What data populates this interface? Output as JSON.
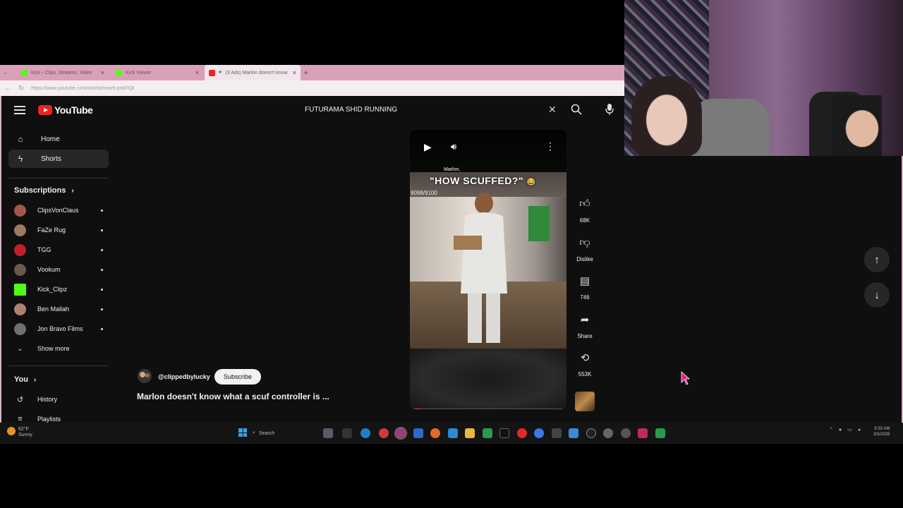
{
  "browser": {
    "tabs": [
      {
        "label": "Kick - Clips, Streams, Video",
        "active": false
      },
      {
        "label": "Kick Viewer",
        "active": false
      },
      {
        "label": "(3 Ads) Marlon doesn't know",
        "active": true
      }
    ],
    "url": "https://www.youtube.com/shorts/mwvh-pn6FQk"
  },
  "youtube": {
    "logo_text": "YouTube",
    "search_query": "FUTURAMA SHID RUNNING",
    "nav": [
      {
        "label": "Home",
        "icon": "home-icon"
      },
      {
        "label": "Shorts",
        "icon": "shorts-icon",
        "active": true
      }
    ],
    "subscriptions_title": "Subscriptions",
    "subscriptions": [
      {
        "name": "ClipsVonClaus",
        "color": "#a0584a"
      },
      {
        "name": "FaZe Rug",
        "color": "#9c7a60"
      },
      {
        "name": "TGG",
        "color": "#c0202a"
      },
      {
        "name": "Vookum",
        "color": "#6a5a4a"
      },
      {
        "name": "Kick_Clipz",
        "color": "#53fc18"
      },
      {
        "name": "Ben Mallah",
        "color": "#b08070"
      },
      {
        "name": "Jon Bravo Films",
        "color": "#707070"
      }
    ],
    "show_more": "Show more",
    "you_title": "You",
    "you_items": [
      {
        "label": "History",
        "icon": "history-icon"
      },
      {
        "label": "Playlists",
        "icon": "playlists-icon"
      }
    ]
  },
  "short": {
    "caption_small": "Marlon,",
    "caption_big": "\"HOW SCUFFED?\"",
    "counter": "9098/9100",
    "progress": 0.05,
    "actions": [
      {
        "icon": "like-icon",
        "label": "68K"
      },
      {
        "icon": "dislike-icon",
        "label": "Dislike"
      },
      {
        "icon": "comment-icon",
        "label": "746"
      },
      {
        "icon": "share-icon",
        "label": "Share"
      },
      {
        "icon": "remix-icon",
        "label": "553K"
      }
    ],
    "channel": "@clippedbylucky",
    "subscribe_label": "Subscribe",
    "title": "Marlon doesn't know what a scuf controller is ..."
  },
  "taskbar": {
    "weather_temp": "62°F",
    "weather_desc": "Sunny",
    "search_label": "Search",
    "time": "9:33 AM",
    "date": "3/3/2026"
  }
}
